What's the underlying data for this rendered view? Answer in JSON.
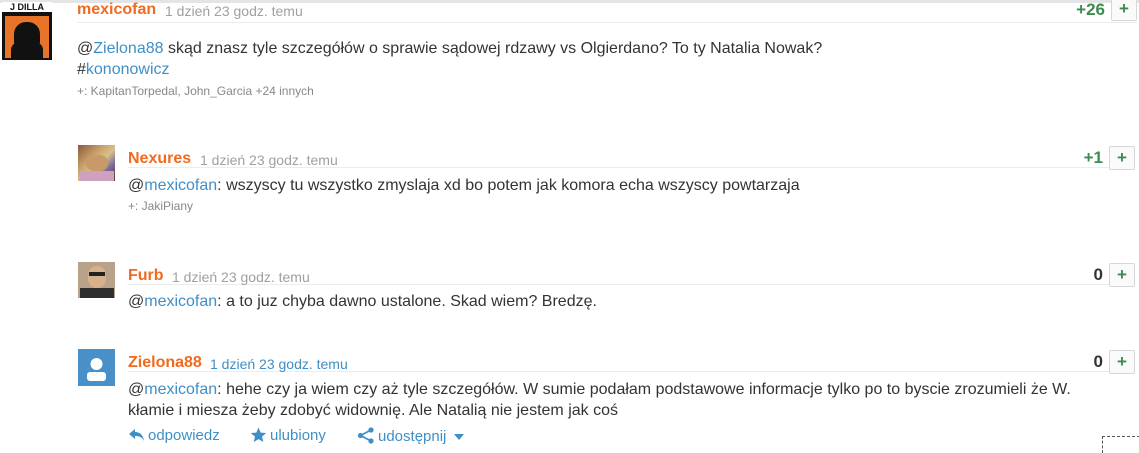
{
  "comments": [
    {
      "author": "mexicofan",
      "time": "1 dzień 23 godz. temu",
      "votes": "+26",
      "plus_button": "+",
      "body": {
        "prefix": "@",
        "mention": "Zielona88",
        "text": " skąd znasz tyle szczegółów o sprawie sądowej rdzawy vs Olgierdano? To ty Natalia Nowak?",
        "tag_prefix": "#",
        "tag": "kononowicz"
      },
      "plus_line": "+: KapitanTorpedal, John_Garcia +24 innych",
      "avatar_text": "J DILLA"
    },
    {
      "author": "Nexures",
      "time": "1 dzień 23 godz. temu",
      "votes": "+1",
      "plus_button": "+",
      "body": {
        "prefix": "@",
        "mention": "mexicofan",
        "text": ": wszyscy tu wszystko zmyslaja xd bo potem jak komora echa wszyscy powtarzaja"
      },
      "plus_line": "+: JakiPiany"
    },
    {
      "author": "Furb",
      "time": "1 dzień 23 godz. temu",
      "votes": "0",
      "plus_button": "+",
      "body": {
        "prefix": "@",
        "mention": "mexicofan",
        "text": ": a to juz chyba dawno ustalone. Skad wiem? Bredzę."
      }
    },
    {
      "author": "Zielona88",
      "time": "1 dzień 23 godz. temu",
      "votes": "0",
      "plus_button": "+",
      "body": {
        "prefix": "@",
        "mention": "mexicofan",
        "text": ": hehe czy ja wiem czy aż tyle szczegółów. W sumie podałam podstawowe informacje tylko po to byscie zrozumieli że W. kłamie i miesza żeby zdobyć widownię. Ale Natalią nie jestem jak coś"
      }
    }
  ],
  "actions": {
    "reply": "odpowiedz",
    "favorite": "ulubiony",
    "share": "udostępnij"
  },
  "colors": {
    "author": "#f06b20",
    "link": "#3f8fc7",
    "vote_positive": "#3b8c4e",
    "time": "#a0a0a0"
  }
}
